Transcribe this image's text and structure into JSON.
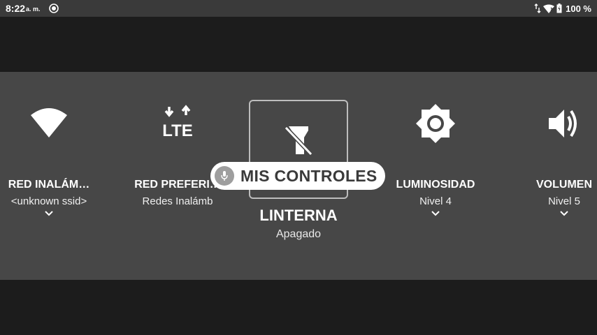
{
  "status": {
    "time": "8:22",
    "ampm": "a. m.",
    "battery": "100 %"
  },
  "tiles": [
    {
      "label": "RED INALÁM…",
      "sub": "<unknown ssid>",
      "icon": "wifi-icon"
    },
    {
      "label": "RED PREFERI…",
      "sub": "Redes Inalámb",
      "icon": "lte-icon",
      "icon_text": "LTE"
    },
    {
      "label": "LINTERNA",
      "sub": "Apagado",
      "icon": "flashlight-off-icon"
    },
    {
      "label": "LUMINOSIDAD",
      "sub": "Nivel 4",
      "icon": "brightness-icon"
    },
    {
      "label": "VOLUMEN",
      "sub": "Nivel 5",
      "icon": "volume-icon"
    }
  ],
  "chip": {
    "label": "MIS CONTROLES",
    "icon": "mic-icon"
  },
  "colors": {
    "status_bar": "#3a3a3a",
    "panel": "#474747",
    "background": "#1c1c1c",
    "chip": "#ffffff"
  }
}
